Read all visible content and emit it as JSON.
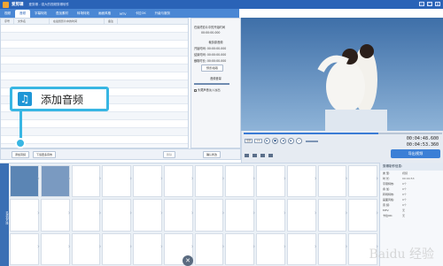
{
  "app": {
    "title": "爱剪辑",
    "subtitle": "爱剪辑 - 强大的视频剪辑软件",
    "window_buttons": [
      "—",
      "□",
      "×"
    ]
  },
  "tabs": [
    {
      "label": "视频",
      "active": false
    },
    {
      "label": "音频",
      "active": true
    },
    {
      "label": "字幕特效",
      "active": false
    },
    {
      "label": "叠加素材",
      "active": false
    },
    {
      "label": "转场特效",
      "active": false
    },
    {
      "label": "画面风格",
      "active": false
    },
    {
      "label": "MTV",
      "active": false
    },
    {
      "label": "卡拉OK",
      "active": false
    },
    {
      "label": "升级与服务",
      "active": false
    }
  ],
  "list": {
    "headers": [
      "序号",
      "文件名",
      "在最终影片中的时间",
      "备注"
    ]
  },
  "settings": {
    "title": "在最终影片中的开始时间",
    "section_clip": "裁剪原音频",
    "start_label": "开始时间:",
    "end_label": "结束时间:",
    "duration_label": "截取时长:",
    "time_value": "00:00:00.000",
    "preview_label": "预览/截取",
    "volume_label": "音频音量",
    "fade_label": "头尾声音淡入淡出",
    "confirm_label": "确认修改"
  },
  "bottombar": {
    "add_audio": "添加音频",
    "download": "下载更多音效",
    "delete": "删除"
  },
  "player": {
    "time_current": "00:04:48.600",
    "time_total": "00:04:53.360",
    "export_label": "导出视频",
    "mode_a": "全屏",
    "mode_b": "1:1"
  },
  "timeline": {
    "side_label": "已添加片段",
    "clip_names": [
      "片段1",
      "片段2"
    ]
  },
  "props": {
    "title": "剪辑制作信息:",
    "rows": [
      {
        "k": "类 型:",
        "v": "视频"
      },
      {
        "k": "时 长:",
        "v": "00:04:53"
      },
      {
        "k": "字幕特效:",
        "v": "0个"
      },
      {
        "k": "叠 加:",
        "v": "0个"
      },
      {
        "k": "转场特效:",
        "v": "0个"
      },
      {
        "k": "画面风格:",
        "v": "0个"
      },
      {
        "k": "音 频:",
        "v": "0个"
      },
      {
        "k": "MTV:",
        "v": "无"
      },
      {
        "k": "卡拉OK:",
        "v": "无"
      }
    ]
  },
  "callout": {
    "text": "添加音频",
    "icon": "music-note-icon"
  },
  "watermark": "Baidu 经验",
  "colors": {
    "accent": "#2a63b7",
    "callout_border": "#38b6e3",
    "export_button": "#3b7fd6"
  }
}
